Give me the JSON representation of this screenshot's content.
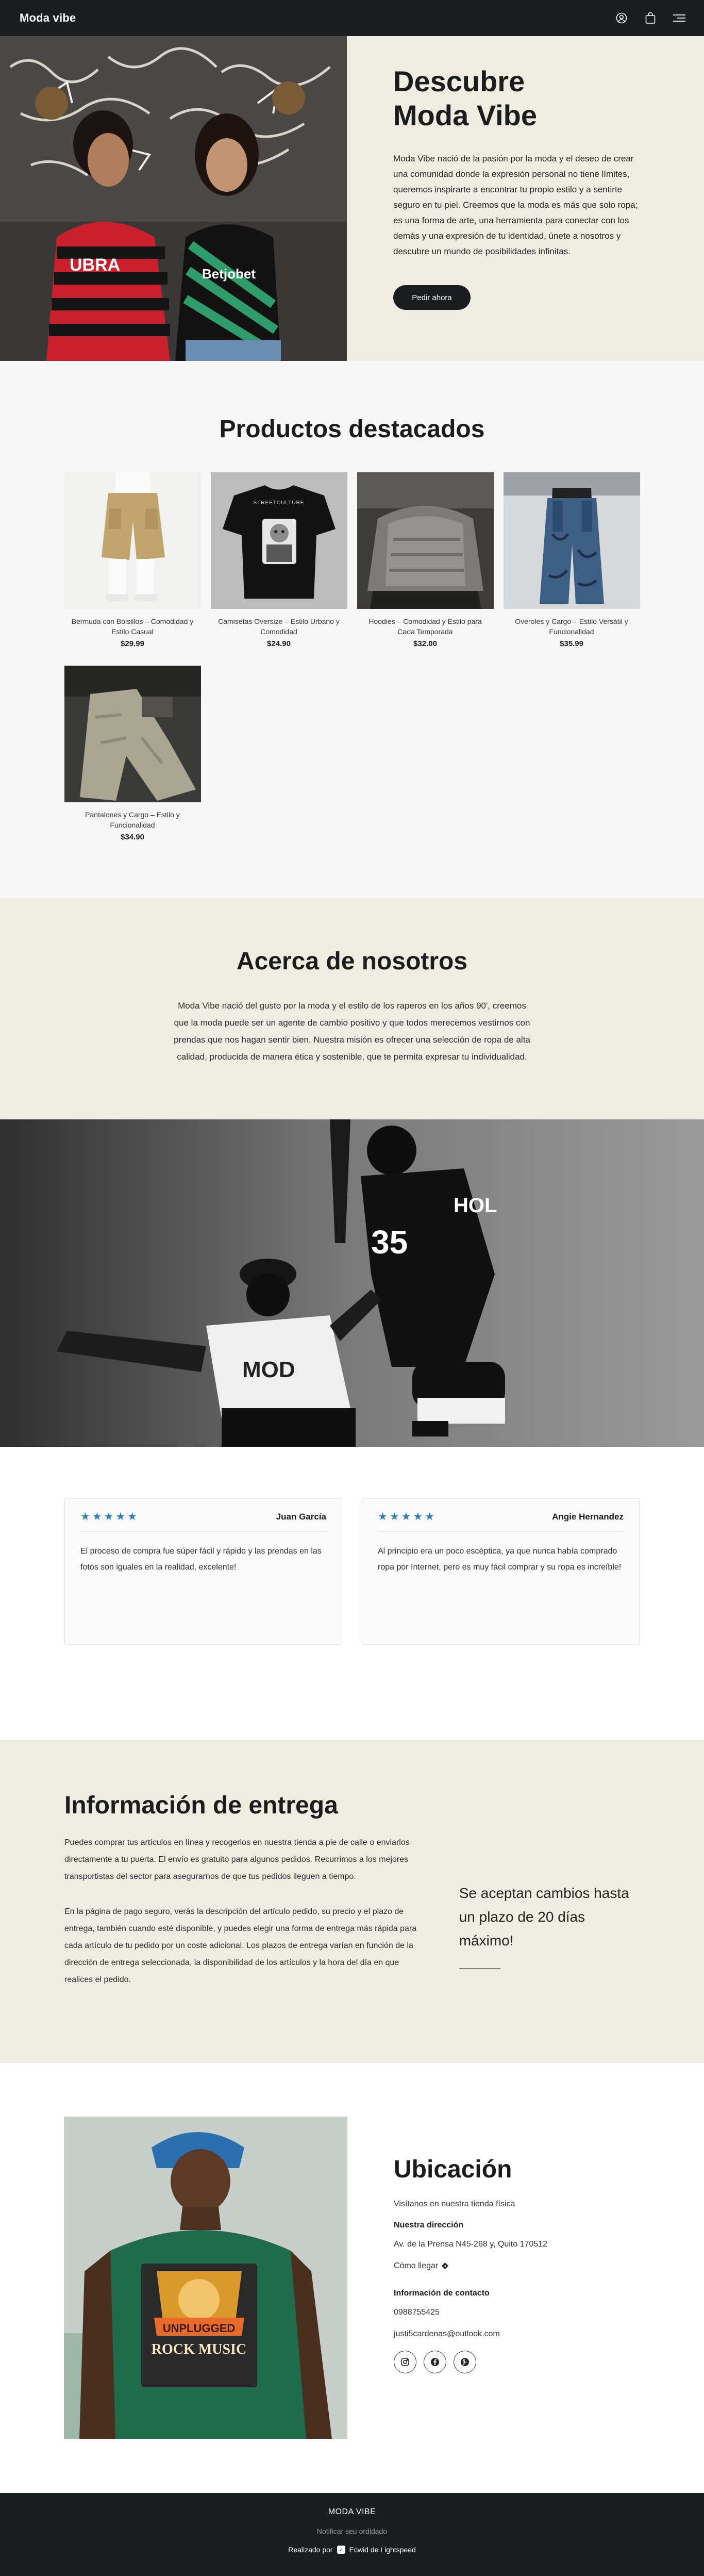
{
  "header": {
    "brand": "Moda vibe",
    "icons": [
      "user-icon",
      "shopping-bag-icon",
      "menu-icon"
    ]
  },
  "hero": {
    "title_line1": "Descubre",
    "title_line2": "Moda Vibe",
    "body": "Moda Vibe nació de la pasión por la moda y el deseo de crear una comunidad donde la expresión personal no tiene límites, queremos inspirarte a encontrar tu propio estilo y a sentirte seguro en tu piel. Creemos que la moda es más que solo ropa; es una forma de arte, una herramienta para conectar con los demás y una expresión de tu identidad, únete a nosotros y descubre un mundo de posibilidades infinitas.",
    "button": "Pedir ahora"
  },
  "products": {
    "title": "Productos destacados",
    "items": [
      {
        "name": "Bermuda con Bolsillos – Comodidad y Estilo Casual",
        "price": "$29.99"
      },
      {
        "name": "Camisetas Oversize – Estilo Urbano y Comodidad",
        "price": "$24.90"
      },
      {
        "name": "Hoodies – Comodidad y Estilo para Cada Temporada",
        "price": "$32.00"
      },
      {
        "name": "Overoles y Cargo – Estilo Versátil y Funcionalidad",
        "price": "$35.99"
      },
      {
        "name": "Pantalones y Cargo – Estilo y Funcionalidad",
        "price": "$34.90"
      }
    ]
  },
  "about": {
    "title": "Acerca de nosotros",
    "body": "Moda Vibe nació del gusto  por la moda y el estilo de los raperos en los años 90', creemos que la moda puede ser un agente de cambio positivo y que todos merecemos vestirnos con prendas que nos hagan sentir bien. Nuestra misión es ofrecer una selección de ropa de alta calidad, producida de manera ética y sostenible, que te permita expresar tu individualidad."
  },
  "reviews": [
    {
      "stars": "★★★★★",
      "name": "Juan García",
      "text": "El proceso de compra fue súper fácil y rápido y las prendas en las fotos son iguales en la realidad, excelente!"
    },
    {
      "stars": "★★★★★",
      "name": "Angie Hernandez",
      "text": "Al principio era un poco escéptica, ya que nunca había comprado ropa por Internet, pero es muy fácil comprar y su ropa es increíble!"
    }
  ],
  "delivery": {
    "title": "Información de entrega",
    "p1": "Puedes comprar tus artículos en línea y recogerlos en nuestra tienda a pie de calle o enviarlos directamente a tu puerta. El envío es gratuito para algunos pedidos. Recurrimos a los mejores transportistas del sector para asegurarnos de que tus pedidos lleguen a tiempo.",
    "p2": "En la página de pago seguro, verás la descripción del artículo pedido, su precio y el plazo de entrega, también cuando esté disponible, y puedes elegir una forma de entrega más rápida para cada artículo de tu pedido por un coste adicional. Los plazos de entrega varían en función de la dirección de entrega seleccionada, la disponibilidad de los artículos y la hora del día en que realices el pedido.",
    "note": "Se aceptan cambios hasta un plazo de 20 días máximo!"
  },
  "location": {
    "title": "Ubicación",
    "intro": "Visítanos en nuestra tienda física",
    "address_heading": "Nuestra dirección",
    "address": "Av. de la Prensa N45-268 y, Quito 170512",
    "directions": "Cómo llegar",
    "contact_heading": "Información de contacto",
    "phone": "0988755425",
    "email": "justi5cardenas@outlook.com",
    "socials": [
      "instagram-icon",
      "facebook-icon",
      "pinterest-icon"
    ]
  },
  "footer": {
    "brand": "MODA VIBE",
    "notify": "Notificar seu ordidado",
    "powered_prefix": "Realizado por",
    "powered_brand": "Ecwid de Lightspeed"
  }
}
